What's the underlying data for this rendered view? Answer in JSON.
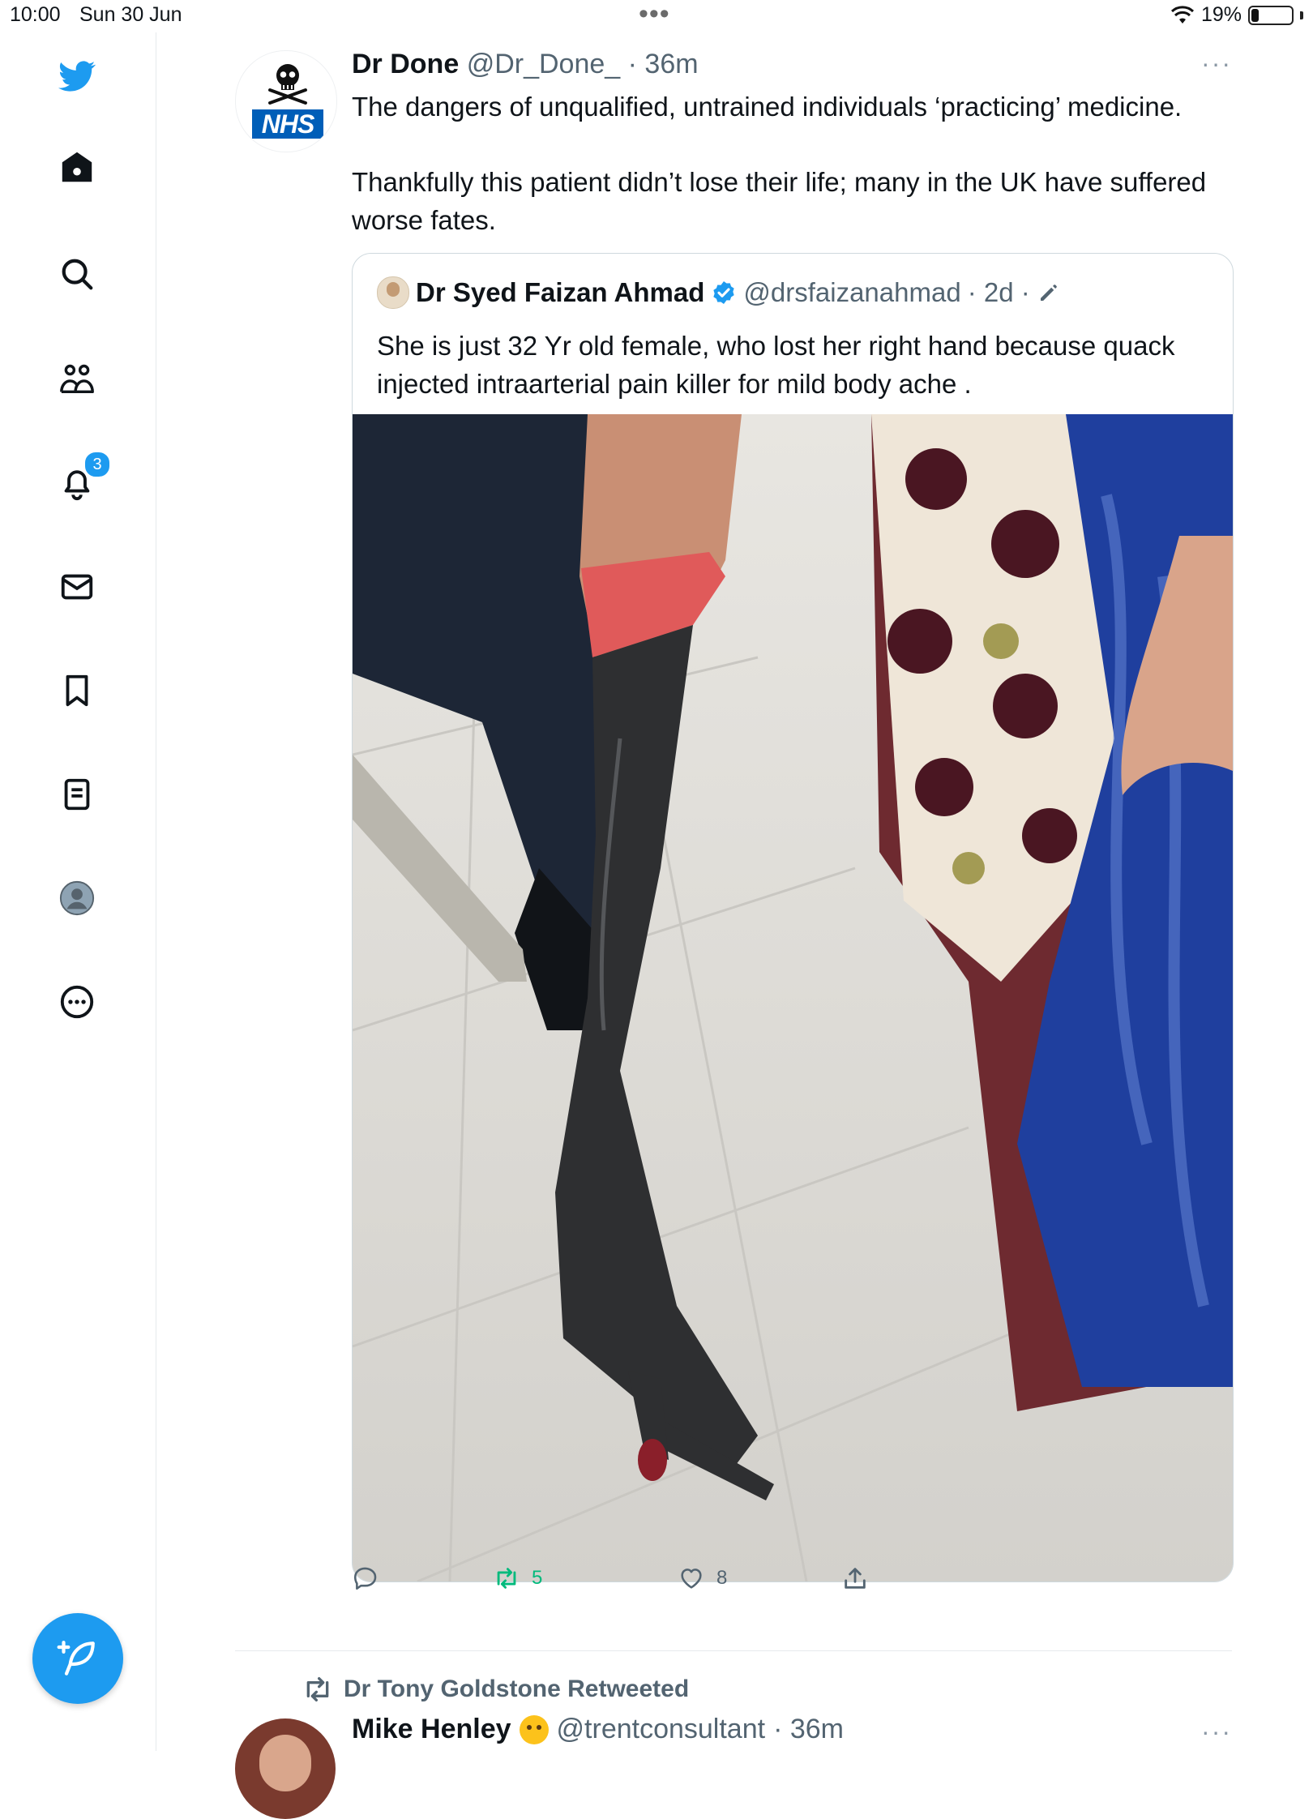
{
  "status_bar": {
    "time": "10:00",
    "date": "Sun 30 Jun",
    "dots": "•••",
    "battery_text": "19%",
    "battery_level": 0.19
  },
  "sidebar": {
    "items": [
      {
        "name": "twitter-logo",
        "icon": "bird-icon"
      },
      {
        "name": "home",
        "icon": "home-icon"
      },
      {
        "name": "explore",
        "icon": "search-icon"
      },
      {
        "name": "communities",
        "icon": "people-icon"
      },
      {
        "name": "notifications",
        "icon": "bell-icon"
      },
      {
        "name": "messages",
        "icon": "mail-icon"
      },
      {
        "name": "bookmarks",
        "icon": "bookmark-icon"
      },
      {
        "name": "lists",
        "icon": "list-icon"
      },
      {
        "name": "profile",
        "icon": "avatar-icon"
      },
      {
        "name": "more",
        "icon": "more-circle-icon"
      }
    ],
    "notification_count": "3",
    "compose_icon": "compose-feather-icon",
    "accent_color": "#1d9bf0"
  },
  "tweet": {
    "author_name": "Dr Done",
    "author_handle": "@Dr_Done_",
    "time": "· 36m",
    "avatar_text": "NHS",
    "more": "···",
    "text_1": "The dangers of unqualified, untrained individuals ‘practicing’ medicine.",
    "text_2": "Thankfully this patient didn’t lose their life; many in the UK have suffered worse fates.",
    "quote": {
      "author_name": "Dr Syed Faizan Ahmad",
      "author_handle": "@drsfaizanahmad",
      "time": "· 2d ·",
      "text": "She is just 32 Yr old female, who lost her right hand because quack injected intraarterial pain killer for mild body ache ."
    },
    "actions": {
      "reply_count": "",
      "retweet_count": "5",
      "like_count": "8"
    }
  },
  "next_tweet": {
    "retweeted_by": "Dr Tony Goldstone Retweeted",
    "author_name": "Mike Henley",
    "author_handle": "@trentconsultant",
    "time": "· 36m",
    "more": "···"
  }
}
